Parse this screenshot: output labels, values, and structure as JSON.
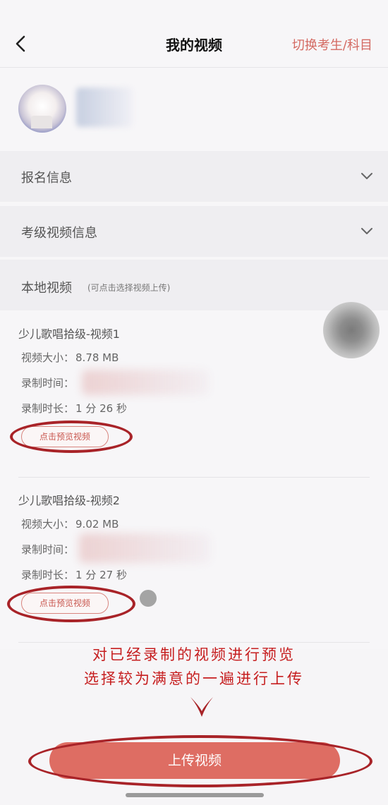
{
  "nav": {
    "title": "我的视频",
    "switch_label": "切换考生/科目"
  },
  "sections": {
    "registration": "报名信息",
    "exam_video_info": "考级视频信息",
    "local_video": "本地视频",
    "local_video_hint": "(可点击选择视频上传)"
  },
  "videos": [
    {
      "title": "少儿歌唱拾级-视频1",
      "size_label": "视频大小：",
      "size_value": "8.78 MB",
      "time_label": "录制时间：",
      "duration_label": "录制时长：",
      "duration_value": "1 分 26 秒",
      "preview_label": "点击预览视频"
    },
    {
      "title": "少儿歌唱拾级-视频2",
      "size_label": "视频大小：",
      "size_value": "9.02 MB",
      "time_label": "录制时间：",
      "duration_label": "录制时长：",
      "duration_value": "1 分 27 秒",
      "preview_label": "点击预览视频"
    }
  ],
  "annotation": {
    "line1": "对已经录制的视频进行预览",
    "line2": "选择较为满意的一遍进行上传"
  },
  "upload_label": "上传视频",
  "colors": {
    "accent": "#de6d63",
    "annotation_red": "#c61e1f",
    "link_red": "#d46a62"
  }
}
